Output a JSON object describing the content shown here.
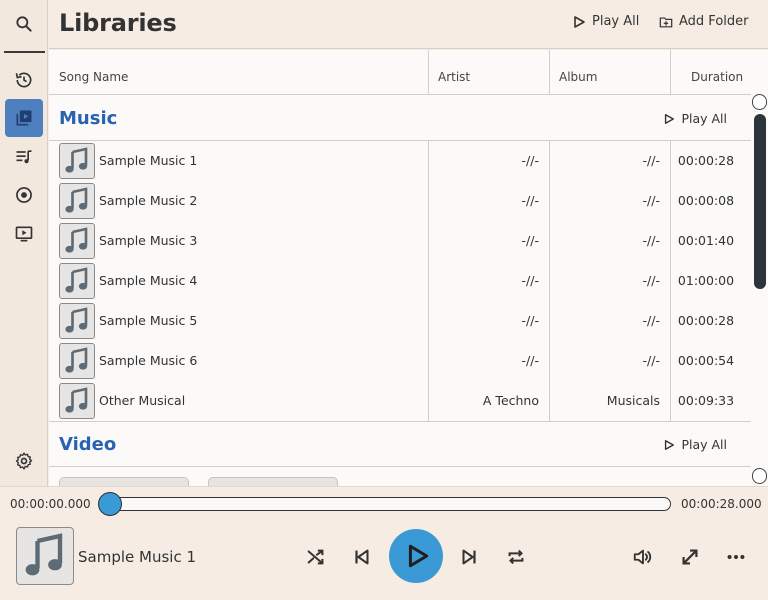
{
  "header": {
    "title": "Libraries",
    "play_all": "Play All",
    "add_folder": "Add Folder"
  },
  "columns": {
    "song_name": "Song Name",
    "artist": "Artist",
    "album": "Album",
    "duration": "Duration"
  },
  "sections": {
    "music": {
      "title": "Music",
      "play_all": "Play All",
      "rows": [
        {
          "name": "Sample Music 1",
          "artist": "-//-",
          "album": "-//-",
          "duration": "00:00:28"
        },
        {
          "name": "Sample Music 2",
          "artist": "-//-",
          "album": "-//-",
          "duration": "00:00:08"
        },
        {
          "name": "Sample Music 3",
          "artist": "-//-",
          "album": "-//-",
          "duration": "00:01:40"
        },
        {
          "name": "Sample Music 4",
          "artist": "-//-",
          "album": "-//-",
          "duration": "01:00:00"
        },
        {
          "name": "Sample Music 5",
          "artist": "-//-",
          "album": "-//-",
          "duration": "00:00:28"
        },
        {
          "name": "Sample Music 6",
          "artist": "-//-",
          "album": "-//-",
          "duration": "00:00:54"
        },
        {
          "name": "Other Musical",
          "artist": "A Techno",
          "album": "Musicals",
          "duration": "00:09:33"
        }
      ]
    },
    "video": {
      "title": "Video",
      "play_all": "Play All"
    }
  },
  "sidebar": {
    "items": [
      {
        "icon": "search-icon"
      },
      {
        "icon": "history-icon"
      },
      {
        "icon": "library-icon",
        "active": true
      },
      {
        "icon": "playlist-icon"
      },
      {
        "icon": "album-icon"
      },
      {
        "icon": "video-icon"
      },
      {
        "icon": "gear-icon"
      }
    ]
  },
  "player": {
    "current_time": "00:00:00.000",
    "total_time": "00:00:28.000",
    "progress": 0.0,
    "now_playing": "Sample Music 1"
  },
  "colors": {
    "accent": "#3a9ad6",
    "section_title": "#2a62b2",
    "active_sidebar": "#4e7fbf",
    "background": "#f6ece3"
  }
}
